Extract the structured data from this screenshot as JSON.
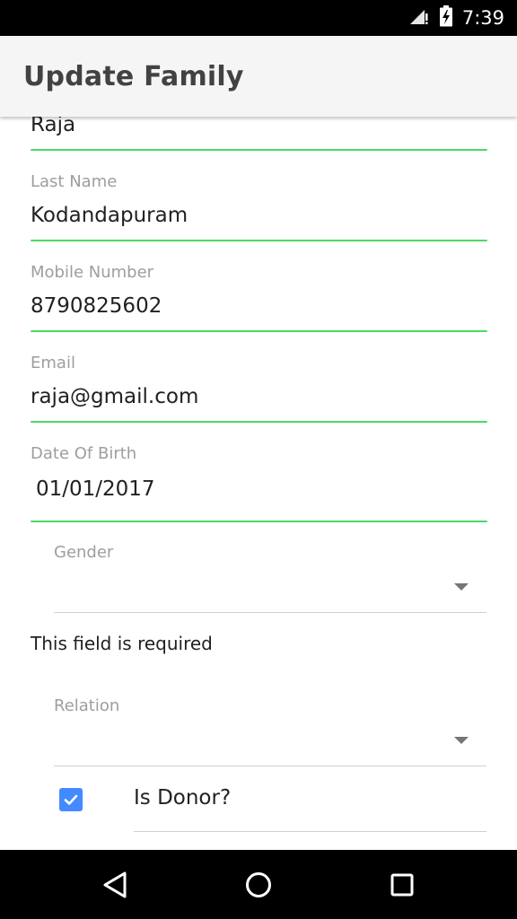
{
  "status_bar": {
    "time": "7:39",
    "icons": [
      "signal-icon",
      "battery-charging-icon"
    ]
  },
  "app_bar": {
    "title": "Update Family"
  },
  "form": {
    "first_name": {
      "value": "Raja"
    },
    "last_name": {
      "label": "Last Name",
      "value": "Kodandapuram"
    },
    "mobile": {
      "label": "Mobile Number",
      "value": "8790825602"
    },
    "email": {
      "label": "Email",
      "value": "raja@gmail.com"
    },
    "dob": {
      "label": "Date Of Birth",
      "value": "01/01/2017"
    },
    "gender": {
      "label": "Gender",
      "value": "",
      "error": "This field is required"
    },
    "relation": {
      "label": "Relation",
      "value": ""
    },
    "is_donor": {
      "label": "Is Donor?",
      "checked": true
    }
  },
  "colors": {
    "accent_underline": "#4cd964",
    "checkbox": "#448aff",
    "label": "#9e9e9e"
  },
  "nav_bar": {
    "icons": [
      "back-icon",
      "home-icon",
      "recents-icon"
    ]
  }
}
